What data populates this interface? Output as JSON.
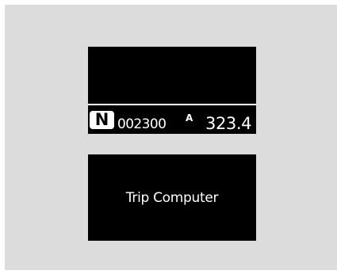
{
  "instrument_display": {
    "gear_indicator": "N",
    "odometer": "002300",
    "trip_label": "A",
    "trip_value": "323.4"
  },
  "info_screen": {
    "title": "Trip Computer"
  },
  "colors": {
    "panel_background": "#dcdcdc",
    "display_background": "#000000",
    "display_text": "#ffffff"
  }
}
